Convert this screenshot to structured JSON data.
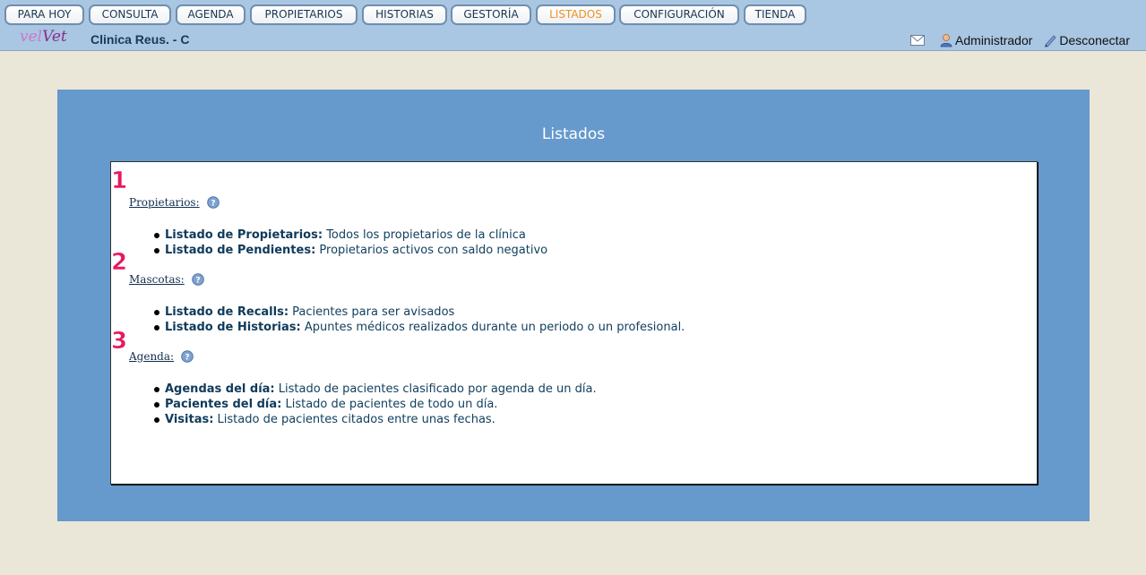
{
  "nav": {
    "items": [
      {
        "label": "PARA HOY"
      },
      {
        "label": "CONSULTA"
      },
      {
        "label": "AGENDA"
      },
      {
        "label": "PROPIETARIOS"
      },
      {
        "label": "HISTORIAS"
      },
      {
        "label": "GESTORÍA"
      },
      {
        "label": "LISTADOS",
        "active": true
      },
      {
        "label": "CONFIGURACIÓN"
      },
      {
        "label": "TIENDA"
      }
    ],
    "active_color": "#f0901d"
  },
  "header": {
    "logo": {
      "part1": "vel",
      "part2": "Vet"
    },
    "clinic_name": "Clinica Reus. - C",
    "mail_icon": "mail-icon",
    "user_label": "Administrador",
    "user_icon": "user-icon",
    "logout_label": "Desconectar",
    "logout_icon": "pencil-icon"
  },
  "main": {
    "title": "Listados",
    "sections": [
      {
        "number": "1",
        "title": "Propietarios:",
        "help_icon": "help-icon",
        "items": [
          {
            "label": "Listado de Propietarios:",
            "desc": "Todos los propietarios de la clínica"
          },
          {
            "label": "Listado de Pendientes:",
            "desc": "Propietarios activos con saldo negativo"
          }
        ]
      },
      {
        "number": "2",
        "title": "Mascotas:",
        "help_icon": "help-icon",
        "items": [
          {
            "label": "Listado de Recalls:",
            "desc": "Pacientes para ser avisados"
          },
          {
            "label": "Listado de Historias:",
            "desc": "Apuntes médicos realizados durante un periodo o un profesional."
          }
        ]
      },
      {
        "number": "3",
        "title": "Agenda:",
        "help_icon": "help-icon",
        "items": [
          {
            "label": "Agendas del día:",
            "desc": "Listado de pacientes clasificado por agenda de un día."
          },
          {
            "label": "Pacientes del día:",
            "desc": "Listado de pacientes de todo un día."
          },
          {
            "label": "Visitas:",
            "desc": "Listado de pacientes citados entre unas fechas."
          }
        ]
      }
    ]
  },
  "colors": {
    "page_bg": "#ebe7d8",
    "topbar_bg": "#a9c6e2",
    "panel_bg": "#6699cc",
    "number_color": "#e8185f"
  }
}
